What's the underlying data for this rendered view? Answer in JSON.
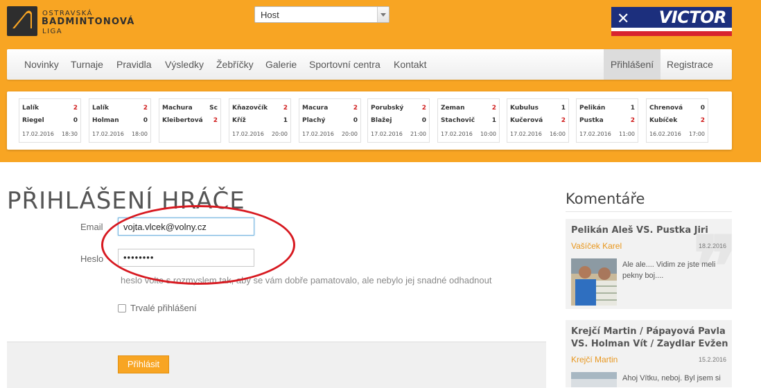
{
  "header": {
    "logo": {
      "line1": "OSTRAVSKÁ",
      "line2": "BADMINTONOVÁ",
      "line3": "LIGA"
    },
    "user_select": {
      "value": "Host"
    },
    "sponsor": "VICTOR",
    "colors": {
      "accent": "#f8a523",
      "sponsor_blue": "#1c2f7d",
      "sponsor_red": "#d8242f"
    }
  },
  "nav": {
    "items": [
      "Novinky",
      "Turnaje",
      "Pravidla",
      "Výsledky",
      "Žebříčky",
      "Galerie",
      "Sportovní centra",
      "Kontakt"
    ],
    "right": [
      "Přihlášení",
      "Registrace"
    ],
    "active": "Přihlášení"
  },
  "matches": [
    {
      "p1": "Lalík",
      "s1": "2",
      "p2": "Riegel",
      "s2": "0",
      "date": "17.02.2016",
      "time": "18:30"
    },
    {
      "p1": "Lalík",
      "s1": "2",
      "p2": "Holman",
      "s2": "0",
      "date": "17.02.2016",
      "time": "18:00"
    },
    {
      "p1": "Machura",
      "s1": "Sc",
      "p2": "Kleibertová",
      "s2": "2",
      "date": "",
      "time": ""
    },
    {
      "p1": "Kňazovčík",
      "s1": "2",
      "p2": "Kříž",
      "s2": "1",
      "date": "17.02.2016",
      "time": "20:00"
    },
    {
      "p1": "Macura",
      "s1": "2",
      "p2": "Plachý",
      "s2": "0",
      "date": "17.02.2016",
      "time": "20:00"
    },
    {
      "p1": "Porubský",
      "s1": "2",
      "p2": "Blažej",
      "s2": "0",
      "date": "17.02.2016",
      "time": "21:00"
    },
    {
      "p1": "Zeman",
      "s1": "2",
      "p2": "Stachovič",
      "s2": "1",
      "date": "17.02.2016",
      "time": "10:00"
    },
    {
      "p1": "Kubulus",
      "s1": "1",
      "p2": "Kučerová",
      "s2": "2",
      "date": "17.02.2016",
      "time": "16:00"
    },
    {
      "p1": "Pelikán",
      "s1": "1",
      "p2": "Pustka",
      "s2": "2",
      "date": "17.02.2016",
      "time": "11:00"
    },
    {
      "p1": "Chrenová",
      "s1": "0",
      "p2": "Kubíček",
      "s2": "2",
      "date": "16.02.2016",
      "time": "17:00"
    }
  ],
  "login": {
    "title": "PŘIHLÁŠENÍ HRÁČE",
    "email_label": "Email",
    "email_value": "vojta.vlcek@volny.cz",
    "password_label": "Heslo",
    "password_value": "••••••••",
    "hint": "heslo volte s rozmyslem tak, aby se vám dobře pamatovalo, ale nebylo jej snadné odhadnout",
    "remember_label": "Trvalé přihlášení",
    "remember_checked": false,
    "submit_label": "Přihlásit"
  },
  "sidebar": {
    "title": "Komentáře",
    "comments": [
      {
        "title": "Pelikán Aleš VS. Pustka Jiri",
        "author": "Vašíček Karel",
        "date": "18.2.2016",
        "text": "Ale ale.... Vidim ze jste meli pekny boj...."
      },
      {
        "title": "Krejčí Martin / Pápayová Pavla VS. Holman Vít / Zaydlar Evžen",
        "author": "Krejčí Martin",
        "date": "15.2.2016",
        "text": "Ahoj Vítku, neboj. Byl jsem si"
      }
    ]
  }
}
